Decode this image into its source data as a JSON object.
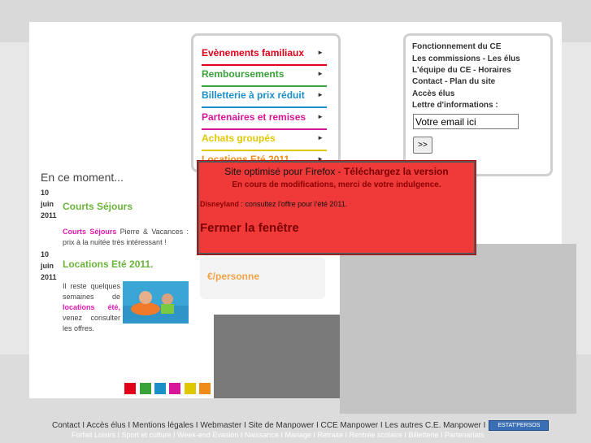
{
  "menu": {
    "items": [
      {
        "label": "Evènements familiaux",
        "color": "#e2001a"
      },
      {
        "label": "Remboursements",
        "color": "#3aa23a"
      },
      {
        "label": "Billetterie à prix réduit",
        "color": "#1b8fc8"
      },
      {
        "label": "Partenaires et remises",
        "color": "#d8169a"
      },
      {
        "label": "Achats groupés",
        "color": "#e0c800"
      },
      {
        "label": "Locations Eté 2011",
        "color": "#f08c1a"
      }
    ],
    "arrow": "►"
  },
  "info": {
    "links": [
      "Fonctionnement du CE",
      "Les commissions - Les élus",
      "L'équipe du CE - Horaires",
      "Contact - Plan du site",
      "Accès élus",
      "Lettre d'informations :"
    ],
    "email_value": "Votre email ici",
    "submit_label": ">>"
  },
  "moment": {
    "title": "En ce moment...",
    "news": [
      {
        "day": "10",
        "month": "juin",
        "year": "2011",
        "title": "Courts Séjours",
        "body_highlight": "Courts Séjours",
        "body": " Pierre & Vacances : prix à la nuitée très intéressant !"
      },
      {
        "day": "10",
        "month": "juin",
        "year": "2011",
        "title": "Locations Eté 2011.",
        "body_a": "Il reste quelques semaines de",
        "body_highlight": "locations été,",
        "body_b": "venez consulter les offres."
      }
    ]
  },
  "ghost": {
    "text": "€/personne"
  },
  "popup": {
    "line1_a": "Site optimisé pour Firefox - ",
    "line1_b": "Téléchargez la version",
    "line2": "En cours de modifications, merci de votre indulgence.",
    "line3_brand": "Disneyland",
    "line3_rest": " : consultez l'offre pour l'été 2011.",
    "close": "Fermer la fenêtre"
  },
  "squares": [
    "#e2001a",
    "#3aa23a",
    "#1b8fc8",
    "#d8169a",
    "#e0c800",
    "#f08c1a"
  ],
  "footer": {
    "line1": "Contact I Accès élus I Mentions légales I Webmaster I Site de Manpower I CCE Manpower I Les autres C.E. Manpower I",
    "badge": "ESTAT'PERSOS",
    "line2": "Forfait Loisirs I Sport et culture I Week-end Evasion I Naissance I Mariage I Retraite I Rentrée scolaire I Billetterie I Partenariats"
  }
}
